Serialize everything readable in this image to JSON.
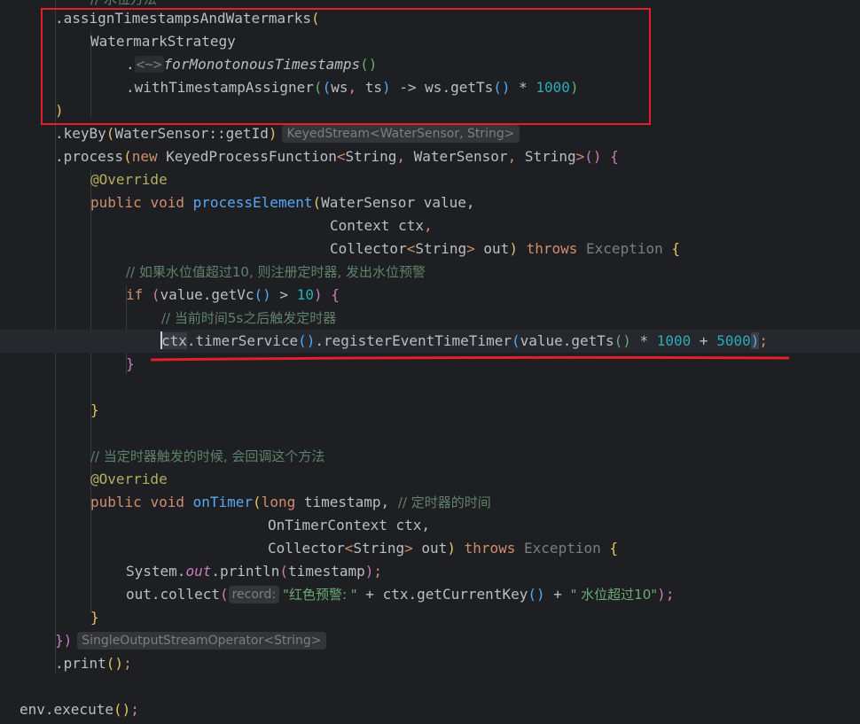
{
  "code_lines": {
    "l0": "// 水位方法",
    "l1_method": ".assignTimestampsAndWatermarks",
    "l2_strategy": "WatermarkStrategy",
    "l3_dot": ".",
    "l3_generic": "<~>",
    "l3_method": "forMonotonousTimestamps",
    "l4_method": ".withTimestampAssigner",
    "l4_ws": "ws",
    "l4_ts": "ts",
    "l4_arrow": " -> ",
    "l4_call": "ws.getTs",
    "l4_mult": " * ",
    "l4_num": "1000",
    "l5_close": ")",
    "l6_method": ".keyBy",
    "l6_arg": "WaterSensor::getId",
    "l6_hint": "KeyedStream<WaterSensor, String>",
    "l7_method": ".process",
    "l7_new": "new ",
    "l7_type": "KeyedProcessFunction",
    "l7_generic_a": "String",
    "l7_generic_b": "WaterSensor",
    "l7_generic_c": "String",
    "l8_ann": "@Override",
    "l9_public": "public ",
    "l9_void": "void ",
    "l9_method": "processElement",
    "l9_param": "WaterSensor value,",
    "l10_param": "Context ",
    "l10_ctx": "ctx",
    "l11_collector": "Collector",
    "l11_string": "String",
    "l11_out": " out",
    "l11_throws": "throws ",
    "l11_exception": "Exception ",
    "l12_comment": "// 如果水位值超过10, 则注册定时器, 发出水位预警",
    "l13_if": "if ",
    "l13_cond": "value.getVc",
    "l13_gt": " > ",
    "l13_num": "10",
    "l14_comment": "// 当前时间5s之后触发定时器",
    "l15_ctx": "ctx",
    "l15_call": ".timerService",
    "l15_register": ".registerEventTimeTimer",
    "l15_value": "value.getTs",
    "l15_mult": " * ",
    "l15_num1": "1000",
    "l15_plus": " + ",
    "l15_num2": "5000",
    "l16_close": "}",
    "l18_close": "}",
    "l20_comment": "// 当定时器触发的时候, 会回调这个方法",
    "l21_ann": "@Override",
    "l22_public": "public ",
    "l22_void": "void ",
    "l22_method": "onTimer",
    "l22_long": "long ",
    "l22_ts": "timestamp, ",
    "l22_comment": "// 定时器的时间",
    "l23_param": "OnTimerContext ctx,",
    "l24_collector": "Collector",
    "l24_string": "String",
    "l24_out": " out",
    "l24_throws": "throws ",
    "l24_exception": "Exception ",
    "l25_system": "System.",
    "l25_out": "out",
    "l25_println": ".println",
    "l25_arg": "timestamp",
    "l26_collect": "out.collect",
    "l26_hint": "record:",
    "l26_str1": "\"红色预警: \"",
    "l26_plus1": " + ",
    "l26_call": "ctx.getCurrentKey",
    "l26_plus2": " + ",
    "l26_str2": "\" 水位超过10\"",
    "l27_close": "}",
    "l28_close": "})",
    "l28_hint": "SingleOutputStreamOperator<String>",
    "l29_print": ".print",
    "l31_env": "env.execute"
  },
  "colors": {
    "annotation_box": "#e0202a",
    "background": "#1e1f22"
  }
}
